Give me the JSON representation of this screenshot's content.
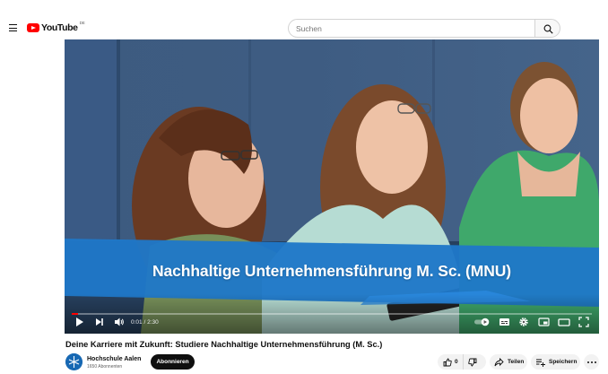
{
  "header": {
    "logo_text": "YouTube",
    "logo_country": "DE",
    "search_placeholder": "Suchen"
  },
  "player": {
    "overlay_title": "Nachhaltige Unternehmensführung M. Sc. (MNU)",
    "current_time": "0:01",
    "separator": " / ",
    "duration": "2:30",
    "progress_fraction": 0.007
  },
  "video": {
    "title": "Deine Karriere mit Zukunft: Studiere Nachhaltige Unternehmensführung (M. Sc.)"
  },
  "channel": {
    "name": "Hochschule Aalen",
    "subscribers": "1650 Abonnenten",
    "subscribe_label": "Abonnieren"
  },
  "actions": {
    "like_count": "0",
    "share_label": "Teilen",
    "save_label": "Speichern"
  },
  "colors": {
    "brand_red": "#ff0000",
    "banner_blue": "#1f78c8",
    "subscribe_bg": "#0f0f0f"
  },
  "icons": [
    "menu-icon",
    "youtube-logo",
    "search-icon",
    "play-icon",
    "next-icon",
    "volume-icon",
    "autoplay-toggle",
    "subtitles-icon",
    "settings-icon",
    "miniplayer-icon",
    "theater-icon",
    "fullscreen-icon",
    "like-icon",
    "dislike-icon",
    "share-icon",
    "save-icon",
    "more-icon"
  ]
}
